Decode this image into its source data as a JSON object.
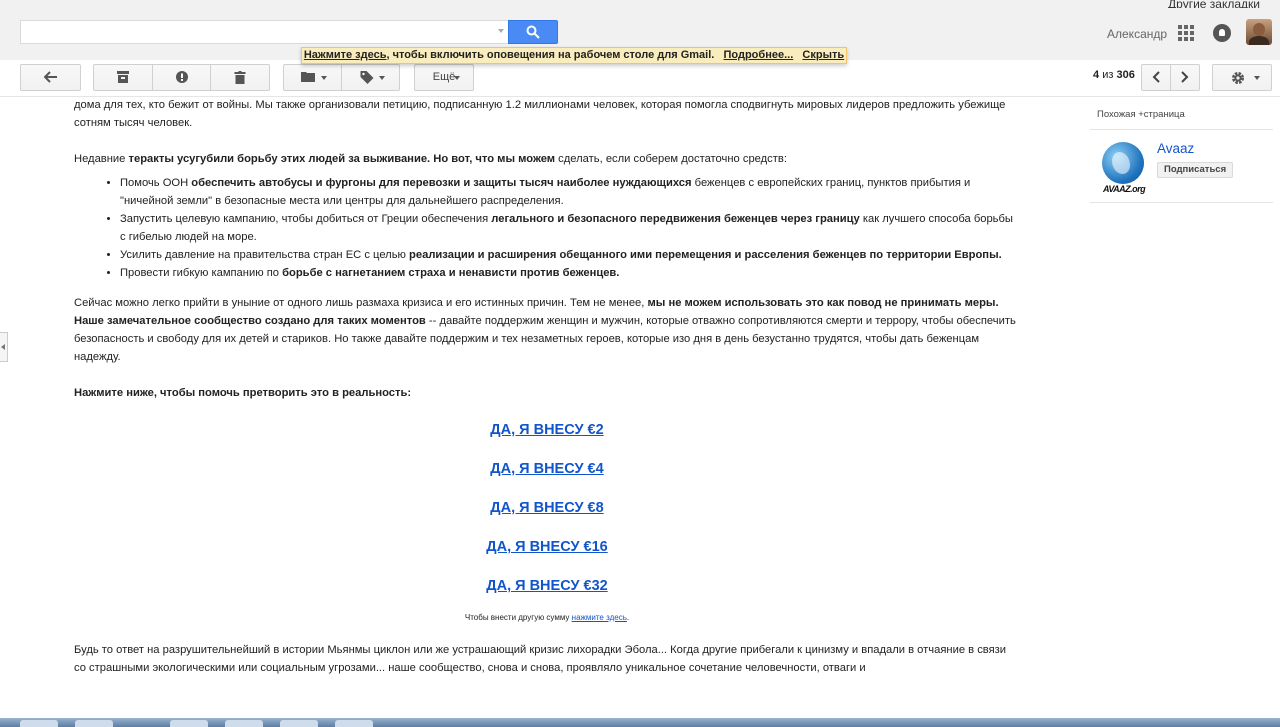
{
  "browser": {
    "bookmarks_label": "Другие закладки"
  },
  "header": {
    "search_placeholder": "",
    "username": "Александр"
  },
  "banner": {
    "link_main": "Нажмите здесь",
    "text_rest": ", чтобы включить оповещения на рабочем столе для Gmail.",
    "more_link": "Подробнее...",
    "hide_link": "Скрыть"
  },
  "toolbar": {
    "more_label": "Ещё",
    "pager_current": "4",
    "pager_sep": "из",
    "pager_total": "306"
  },
  "email": {
    "intro_para": "дома для тех, кто бежит от войны. Мы также организовали петицию, подписанную 1.2 миллионами человек, которая помогла сподвигнуть мировых лидеров предложить убежище сотням тысяч человек.",
    "p2_a": "Недавние ",
    "p2_bold": "теракты усугубили борьбу этих людей за выживание. Но вот, что мы можем",
    "p2_c": " сделать, если соберем достаточно средств:",
    "bullets": [
      {
        "pre": "Помочь ООН ",
        "bold": "обеспечить автобусы и фургоны для перевозки и защиты тысяч наиболее нуждающихся",
        "post": " беженцев с европейских границ, пунктов прибытия и \"ничейной земли\" в безопасные места или центры для дальнейшего распределения."
      },
      {
        "pre": "Запустить целевую кампанию, чтобы добиться от Греции обеспечения ",
        "bold": "легального и безопасного передвижения беженцев через границу",
        "post": " как лучшего способа борьбы с гибелью людей на море."
      },
      {
        "pre": "Усилить давление на правительства стран ЕС с целью ",
        "bold": "реализации и расширения обещанного ими перемещения и расселения беженцев по территории Европы.",
        "post": ""
      },
      {
        "pre": "Провести гибкую кампанию по ",
        "bold": "борьбе с нагнетанием страха и ненависти против беженцев.",
        "post": ""
      }
    ],
    "p3_a": "Сейчас можно легко прийти в уныние от одного лишь размаха кризиса и его истинных причин. Тем не менее, ",
    "p3_bold": "мы не можем использовать это как повод не принимать меры. Наше замечательное сообщество создано для таких моментов",
    "p3_c": " -- давайте поддержим женщин и мужчин, которые отважно сопротивляются смерти и террору, чтобы обеспечить безопасность и свободу для их детей и стариков. Но также давайте поддержим и тех незаметных героев, которые изо дня в день безустанно трудятся, чтобы дать беженцам надежду.",
    "cta_heading": "Нажмите ниже, чтобы помочь претворить это в реальность:",
    "donate_links": [
      "ДА, Я ВНЕСУ €2",
      "ДА, Я ВНЕСУ €4",
      "ДА, Я ВНЕСУ €8",
      "ДА, Я ВНЕСУ €16",
      "ДА, Я ВНЕСУ €32"
    ],
    "other_sum_text": "Чтобы внести другую сумму ",
    "other_sum_link": "нажмите здесь",
    "other_sum_end": ".",
    "closing": "Будь то ответ на разрушительнейший в истории Мьянмы циклон или же устрашающий кризис лихорадки Эбола... Когда другие прибегали к цинизму и впадали в отчаяние в связи со страшными экологическими или социальным угрозами... наше сообщество, снова и снова, проявляло уникальное сочетание человечности, отваги и"
  },
  "sidebar": {
    "related_label": "Похожая +страница",
    "sender_name": "Avaaz",
    "logo_text": "AVAAZ.org",
    "subscribe_label": "Подписаться"
  }
}
